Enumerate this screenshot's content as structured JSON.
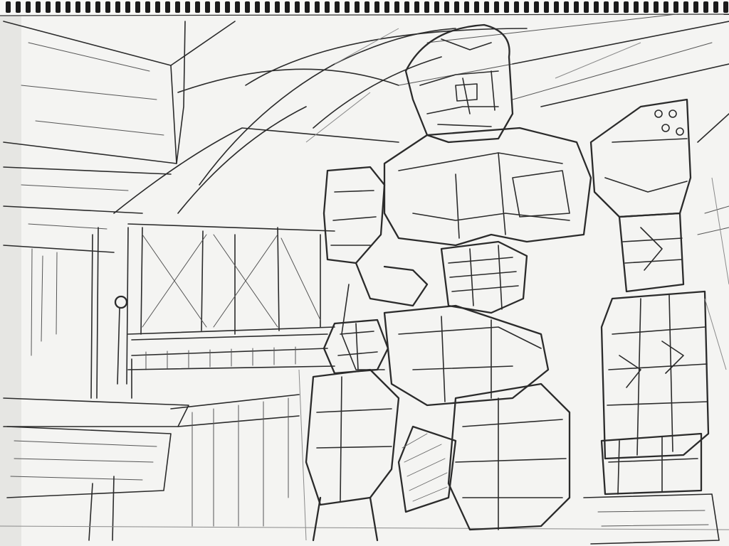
{
  "artwork": {
    "subject_icon": "mech-robot-icon",
    "colors": {
      "paper": "#f4f4f2",
      "graphite": "#2b2b2b",
      "graphite_light": "#8a8a8a",
      "binding": "#1a1a1a"
    }
  }
}
